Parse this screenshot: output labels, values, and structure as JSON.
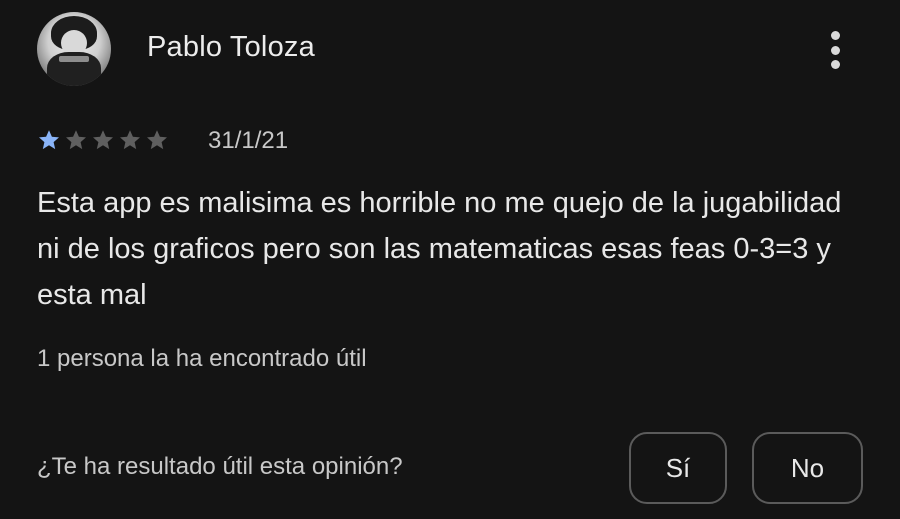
{
  "review": {
    "author": "Pablo Toloza",
    "avatar_icon": "user-avatar",
    "menu_icon": "more-vert-icon",
    "rating": 1,
    "max_rating": 5,
    "date": "31/1/21",
    "text": "Esta app es malisima es horrible no me quejo de la jugabilidad ni de los graficos pero son las matematicas esas feas 0-3=3 y esta mal",
    "helpful_count_text": "1 persona la ha encontrado útil"
  },
  "feedback": {
    "question": "¿Te ha resultado útil esta opinión?",
    "yes_label": "Sí",
    "no_label": "No"
  },
  "colors": {
    "background": "#141414",
    "star_filled": "#8ab4f8",
    "star_empty": "#5f5f5f",
    "text_primary": "#e8e8e8",
    "text_secondary": "#c8c8c8",
    "button_border": "#5b5b5b"
  }
}
